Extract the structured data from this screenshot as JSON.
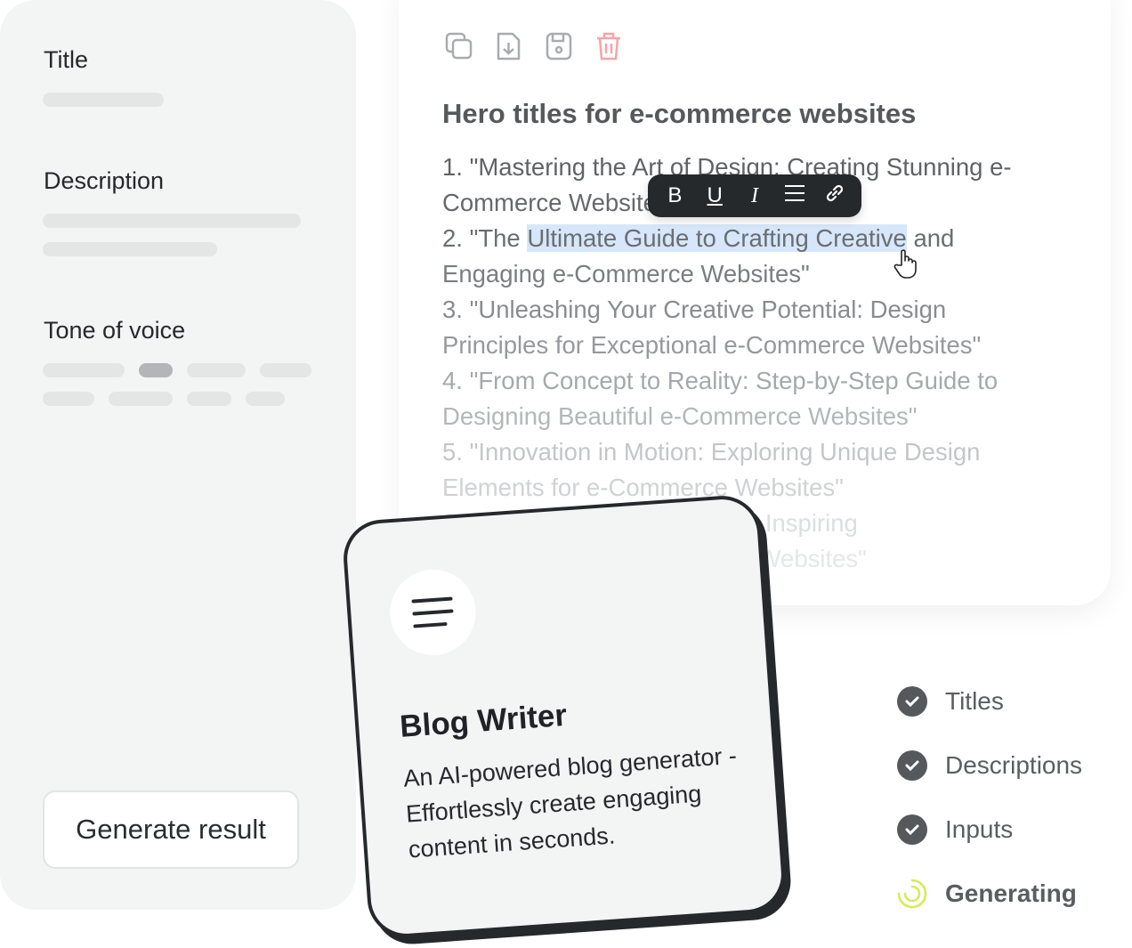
{
  "form": {
    "title_label": "Title",
    "description_label": "Description",
    "tone_label": "Tone of voice",
    "generate_label": "Generate result"
  },
  "toolbar": {
    "icons": [
      "copy-icon",
      "download-file-icon",
      "save-icon",
      "trash-icon"
    ],
    "trash_color": "#f7a3a8"
  },
  "editor": {
    "heading": "Hero titles for e-commerce websites",
    "lines": [
      {
        "text": "1. \"Mastering the Art of Design: Creating Stunning e-"
      },
      {
        "text": "Commerce Websites\""
      },
      {
        "pre": "2. \"The ",
        "sel": "Ultimate Guide to Crafting Creative",
        "post": " and"
      },
      {
        "text": "Engaging e-Commerce Websites\""
      },
      {
        "text": "3. \"Unleashing Your Creative Potential: Design"
      },
      {
        "text": "Principles for Exceptional e-Commerce Websites\""
      },
      {
        "text": "4. \"From Concept to Reality: Step-by-Step Guide to"
      },
      {
        "text": "Designing Beautiful e-Commerce Websites\""
      },
      {
        "text": "5. \"Innovation in Motion: Exploring Unique Design"
      },
      {
        "text": "Elements for e-Commerce Websites\""
      },
      {
        "text": "6. \"The Power of Storytelling: Inspiring"
      },
      {
        "text": "Experiences in e-Commerce Websites\""
      }
    ],
    "format_bar": {
      "bold": "B",
      "underline": "U",
      "italic": "I"
    }
  },
  "card": {
    "title": "Blog Writer",
    "description": "An AI-powered blog generator - Effortlessly create engaging content in seconds."
  },
  "steps": [
    {
      "label": "Titles",
      "status": "done"
    },
    {
      "label": "Descriptions",
      "status": "done"
    },
    {
      "label": "Inputs",
      "status": "done"
    },
    {
      "label": "Generating",
      "status": "in-progress"
    }
  ],
  "colors": {
    "accent": "#d4ec5b",
    "selection": "#d7e7fb",
    "dark": "#26292c"
  }
}
